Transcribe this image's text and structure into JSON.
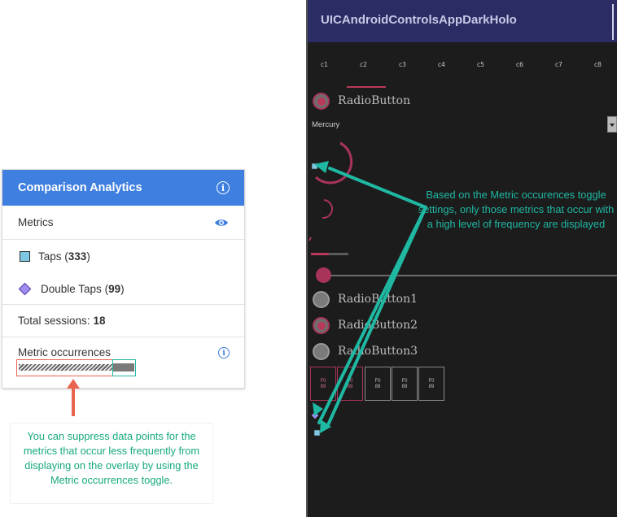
{
  "panel": {
    "title": "Comparison Analytics",
    "metrics_label": "Metrics",
    "metrics": [
      {
        "name": "Taps",
        "count": "333",
        "marker": "square",
        "color": "#7ec8e3"
      },
      {
        "name": "Double Taps",
        "count": "99",
        "marker": "diamond",
        "color": "#a08cf0"
      }
    ],
    "total_sessions_label": "Total sessions:",
    "total_sessions_value": "18",
    "occurrences_label": "Metric occurrences",
    "header_color": "#3e7fe0",
    "icons": {
      "header_info": "info-icon",
      "metrics_visibility": "eye-icon",
      "occurrences_info": "info-icon"
    }
  },
  "app": {
    "title": "UICAndroidControlsAppDarkHolo",
    "columns": [
      "c1",
      "c2",
      "c3",
      "c4",
      "c5",
      "c6",
      "c7",
      "c8"
    ],
    "radio_button": "RadioButton",
    "spinner_value": "Mercury",
    "radio_group": [
      "RadioButton1",
      "RadioButton2",
      "RadioButton3"
    ],
    "radio_group_selected": "RadioButton2",
    "toggle_boxes": [
      {
        "l1": "F0",
        "l2": "89"
      },
      {
        "l1": "F0",
        "l2": "89"
      },
      {
        "l1": "F0",
        "l2": "89"
      },
      {
        "l1": "F0",
        "l2": "89"
      },
      {
        "l1": "F0",
        "l2": "89"
      }
    ],
    "accent": "#b8395a",
    "title_bar_color": "#2a2c63"
  },
  "callouts": {
    "right": "Based on the Metric occurences toggle settings, only those metrics that occur with a high level of frequency are displayed",
    "bottom": "You can suppress data points for the metrics that occur less frequently from displaying on the overlay by using the Metric occurrences toggle.",
    "colors": {
      "teal": "#1fb8a2",
      "red": "#e8644f",
      "green": "#16a97f"
    }
  }
}
